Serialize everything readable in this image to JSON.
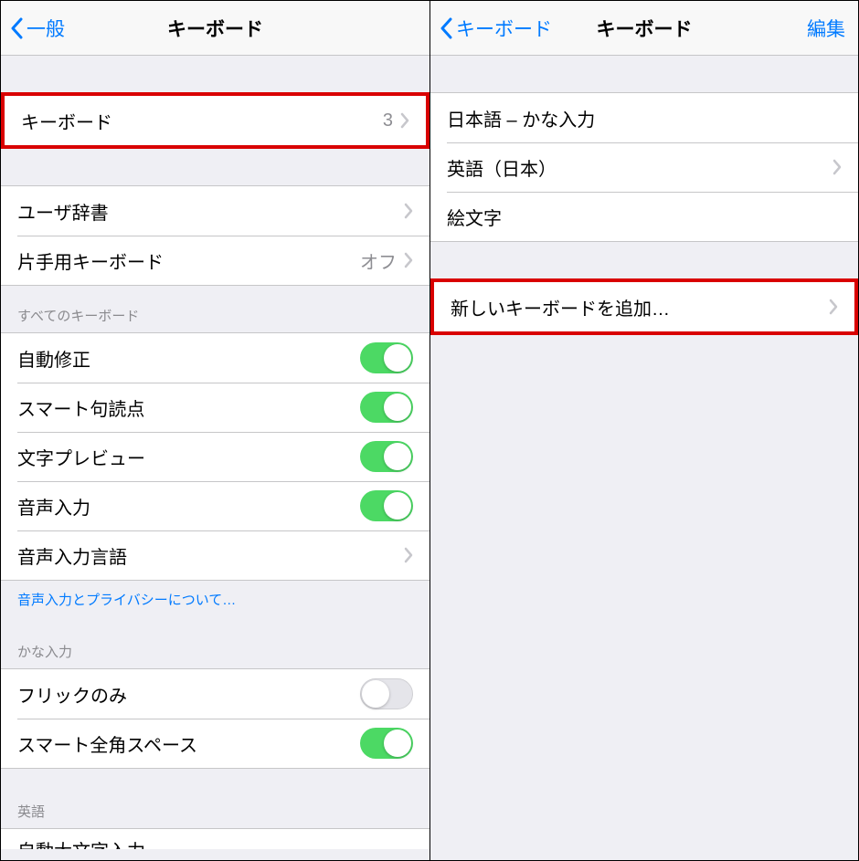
{
  "left": {
    "nav": {
      "back": "一般",
      "title": "キーボード"
    },
    "topGroup": {
      "keyboard": {
        "label": "キーボード",
        "count": "3"
      }
    },
    "secondGroup": {
      "userDict": {
        "label": "ユーザ辞書"
      },
      "oneHanded": {
        "label": "片手用キーボード",
        "value": "オフ"
      }
    },
    "allKeyboardsHeader": "すべてのキーボード",
    "togglesGroup": {
      "autoCorrect": {
        "label": "自動修正"
      },
      "smartPunct": {
        "label": "スマート句読点"
      },
      "charPreview": {
        "label": "文字プレビュー"
      },
      "dictation": {
        "label": "音声入力"
      },
      "dictationLang": {
        "label": "音声入力言語"
      }
    },
    "privacyLink": "音声入力とプライバシーについて…",
    "kanaHeader": "かな入力",
    "kanaGroup": {
      "flickOnly": {
        "label": "フリックのみ"
      },
      "smartFullwidth": {
        "label": "スマート全角スペース"
      }
    },
    "englishHeader": "英語",
    "englishGroup": {
      "autoCaps": {
        "label": "自動大文字入力"
      }
    }
  },
  "right": {
    "nav": {
      "back": "キーボード",
      "title": "キーボード",
      "edit": "編集"
    },
    "kbList": {
      "jp": "日本語 – かな入力",
      "en": "英語（日本）",
      "emoji": "絵文字"
    },
    "addNew": "新しいキーボードを追加…"
  }
}
